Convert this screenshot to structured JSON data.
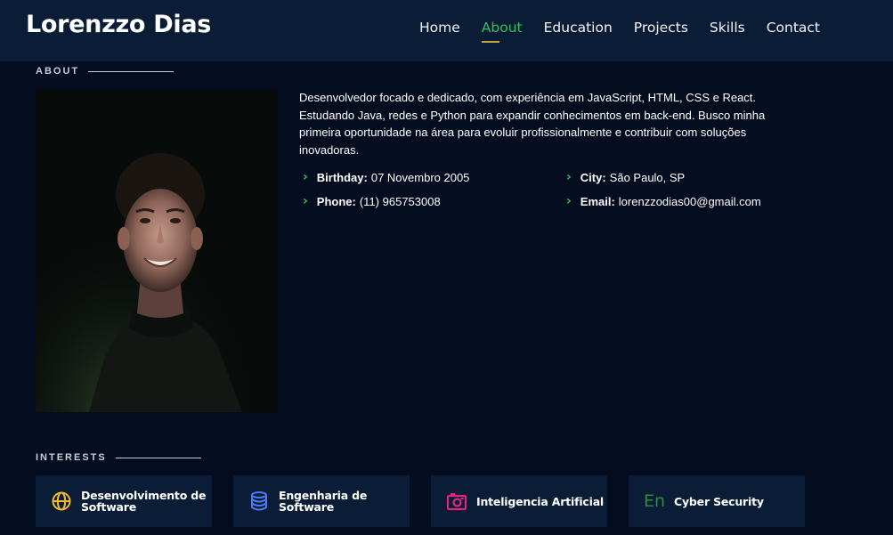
{
  "header": {
    "brand": "Lorenzzo Dias",
    "nav": [
      "Home",
      "About",
      "Education",
      "Projects",
      "Skills",
      "Contact"
    ],
    "active": "About"
  },
  "about": {
    "title": "ABOUT",
    "photo_alt": "Profile photo",
    "description": "Desenvolvedor focado e dedicado, com experiência em JavaScript, HTML, CSS e React. Estudando Java, redes e Python para expandir conhecimentos em back-end. Busco minha primeira oportunidade na área para evoluir profissionalmente e contribuir com soluções inovadoras.",
    "info": {
      "birthday_label": "Birthday:",
      "birthday_value": "07 Novembro 2005",
      "city_label": "City:",
      "city_value": "São Paulo, SP",
      "phone_label": "Phone:",
      "phone_value": "(11) 965753008",
      "email_label": "Email:",
      "email_value": "lorenzzodias00@gmail.com"
    }
  },
  "interests": {
    "title": "INTERESTS",
    "items": [
      {
        "label": "Desenvolvimento de Software",
        "icon": "globe-icon",
        "color": "#f5b82e"
      },
      {
        "label": "Engenharia de Software",
        "icon": "database-icon",
        "color": "#4a7cf7"
      },
      {
        "label": "Inteligencia Artificial",
        "icon": "camera-icon",
        "color": "#e0287a"
      },
      {
        "label": "Cyber Security",
        "icon": "language-icon",
        "icon_text": "En",
        "color": "#2e8b3d"
      }
    ]
  },
  "colors": {
    "accent": "#2ec35c",
    "header_bg": "#0b1d36",
    "page_bg": "#040d1f"
  }
}
